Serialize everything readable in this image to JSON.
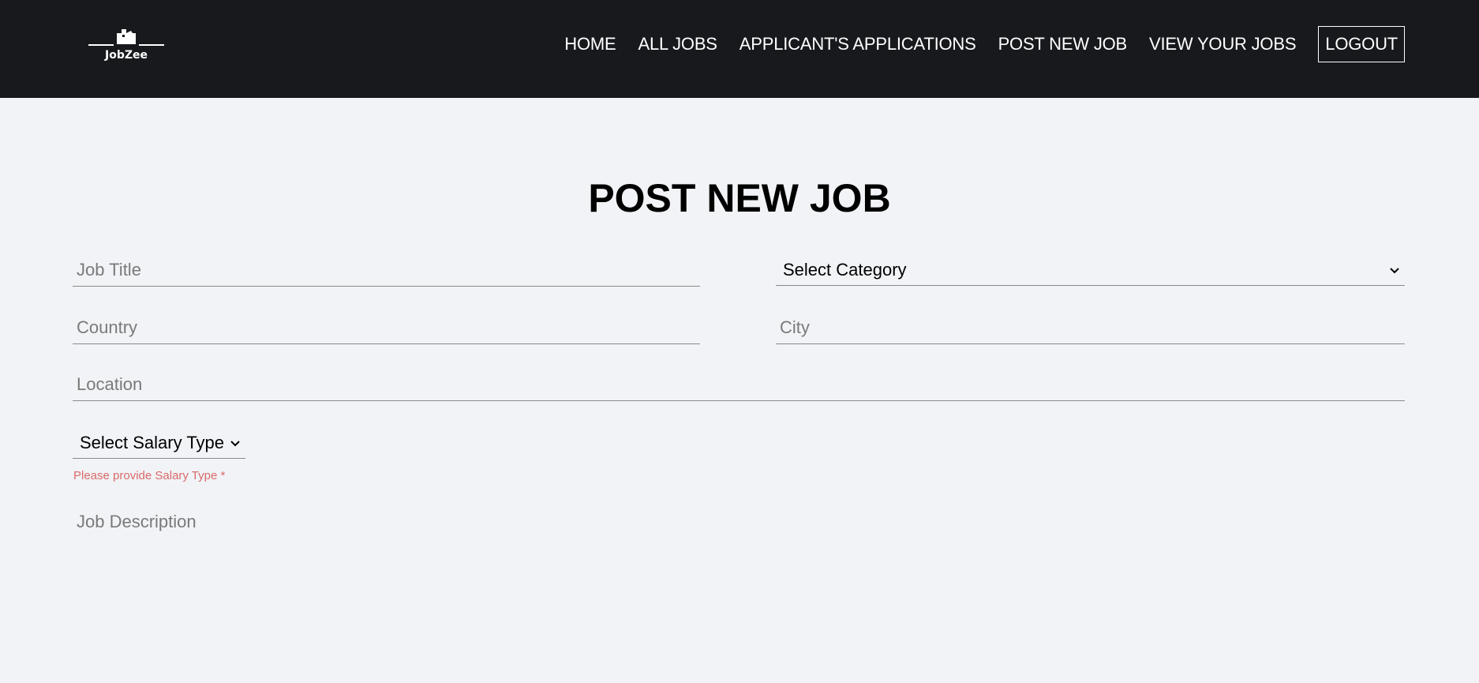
{
  "brand": {
    "name": "JobZee"
  },
  "nav": {
    "items": [
      {
        "label": "HOME"
      },
      {
        "label": "ALL JOBS"
      },
      {
        "label": "APPLICANT'S APPLICATIONS"
      },
      {
        "label": "POST NEW JOB"
      },
      {
        "label": "VIEW YOUR JOBS"
      }
    ],
    "logout_label": "LOGOUT"
  },
  "page": {
    "title": "POST NEW JOB"
  },
  "form": {
    "job_title": {
      "placeholder": "Job Title",
      "value": ""
    },
    "category": {
      "selected": "Select Category"
    },
    "country": {
      "placeholder": "Country",
      "value": ""
    },
    "city": {
      "placeholder": "City",
      "value": ""
    },
    "location": {
      "placeholder": "Location",
      "value": ""
    },
    "salary_type": {
      "selected": "Select Salary Type"
    },
    "salary_error": "Please provide Salary Type *",
    "description": {
      "placeholder": "Job Description",
      "value": ""
    }
  },
  "colors": {
    "navbar_bg": "#18191d",
    "page_bg": "#f1f3f6",
    "error": "#d96a6a"
  }
}
